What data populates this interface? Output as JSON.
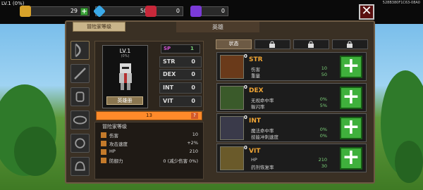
{
  "topbar": {
    "level": "LV.1 (0%)",
    "uid": "528B380F1C63-08A0",
    "gold": "29",
    "gems": "50",
    "red_gems": "0",
    "purple_gems": "0"
  },
  "tabs": {
    "adventure_level": "冒险家等级",
    "hero": "英雄"
  },
  "character": {
    "level": "LV.1",
    "percent": "(0%)",
    "hero_button": "英雄册",
    "sp_label": "SP",
    "sp_value": "1",
    "stats": [
      {
        "name": "STR",
        "value": "0"
      },
      {
        "name": "DEX",
        "value": "0"
      },
      {
        "name": "INT",
        "value": "0"
      },
      {
        "name": "VIT",
        "value": "0"
      }
    ]
  },
  "progress": {
    "value": "13",
    "fraction": 0.0
  },
  "info": {
    "title": "冒险家等级",
    "rows": [
      {
        "label": "伤害",
        "value": "10"
      },
      {
        "label": "攻击速度",
        "value": "+2%"
      },
      {
        "label": "HP",
        "value": "210"
      },
      {
        "label": "防御力",
        "value": "0 (减少伤害 0%)"
      }
    ]
  },
  "right_tabs": {
    "status": "状态"
  },
  "attributes": [
    {
      "zero": "0",
      "name": "STR",
      "l1": "伤害",
      "v1": "10",
      "l2": "重量",
      "v2": "50"
    },
    {
      "zero": "0",
      "name": "DEX",
      "l1": "无视命中率",
      "v1": "0%",
      "l2": "躲闪率",
      "v2": "5%"
    },
    {
      "zero": "0",
      "name": "INT",
      "l1": "魔法命中率",
      "v1": "0%",
      "l2": "技能冲刺速度",
      "v2": "0%"
    },
    {
      "zero": "0",
      "name": "VIT",
      "l1": "HP",
      "v1": "210",
      "l2": "药剂恢复率",
      "v2": "30"
    }
  ],
  "colors": {
    "accent_green": "#3fb03c",
    "attr_orange": "#f2a634",
    "progress_orange": "#ff8a2a"
  }
}
